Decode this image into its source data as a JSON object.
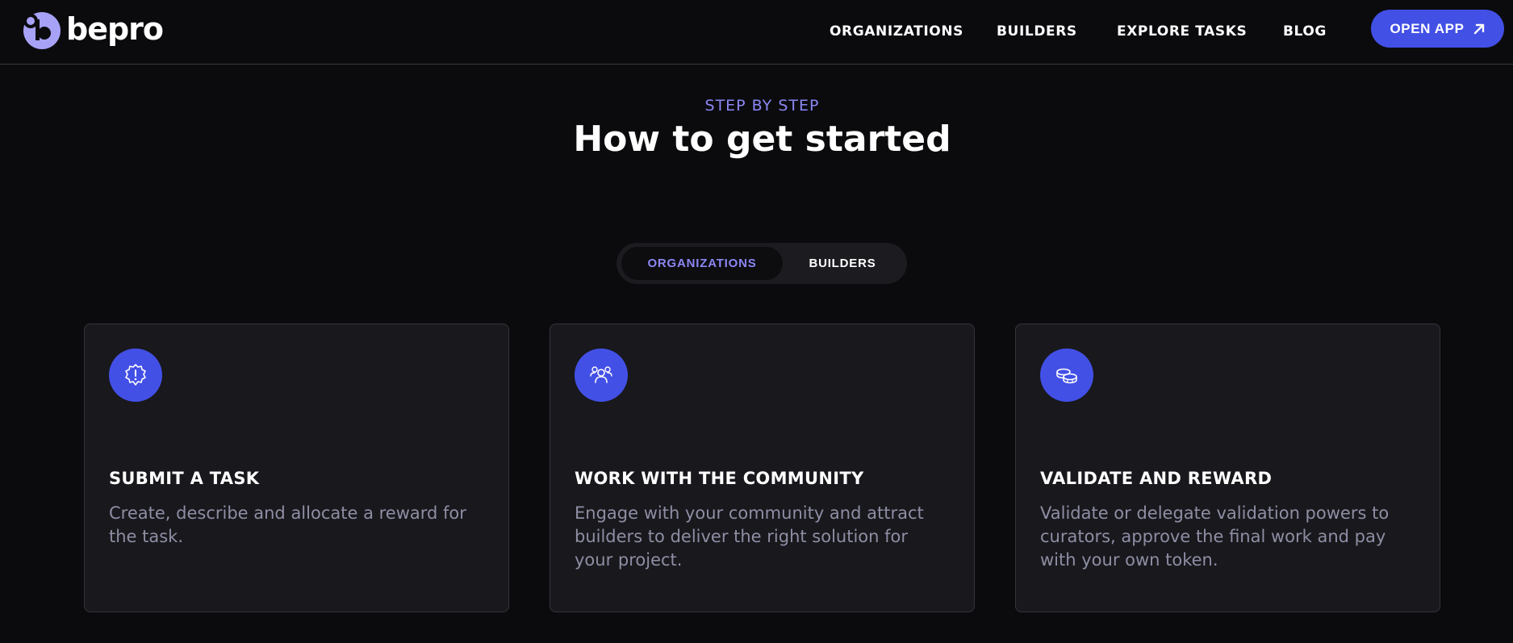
{
  "header": {
    "logo_text": "bepro",
    "nav": [
      "ORGANIZATIONS",
      "BUILDERS",
      "EXPLORE TASKS",
      "BLOG"
    ],
    "cta_label": "OPEN APP",
    "cta_icon": "arrow-up-right-icon"
  },
  "hero": {
    "eyebrow": "STEP BY STEP",
    "title": "How to get started"
  },
  "toggle": {
    "options": [
      "ORGANIZATIONS",
      "BUILDERS"
    ],
    "selected": "ORGANIZATIONS"
  },
  "cards": [
    {
      "icon": "badge-alert-icon",
      "title": "SUBMIT A TASK",
      "description": "Create, describe and allocate a reward for the task."
    },
    {
      "icon": "users-icon",
      "title": "WORK WITH THE COMMUNITY",
      "description": "Engage with your community and attract builders to deliver the right solution for your project."
    },
    {
      "icon": "coins-icon",
      "title": "VALIDATE AND REWARD",
      "description": "Validate or delegate validation powers to curators, approve the final work and pay with your own token."
    }
  ],
  "colors": {
    "background": "#0b0b0e",
    "accent": "#4350e6",
    "accent_text": "#8b87f4",
    "card_bg": "#18181d",
    "muted_text": "#8e8ea4"
  }
}
